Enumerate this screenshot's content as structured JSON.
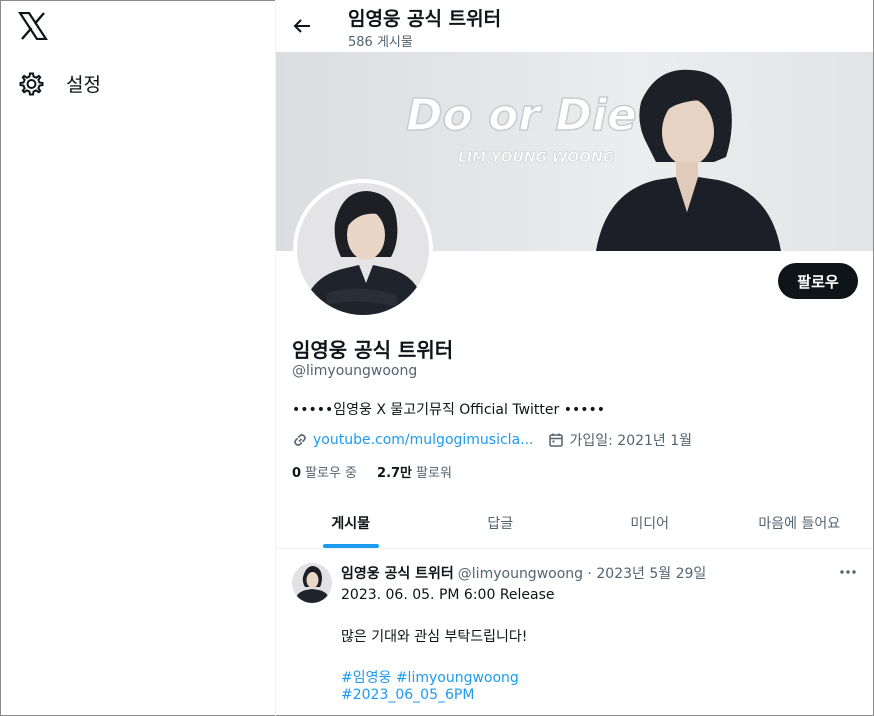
{
  "nav": {
    "settings_label": "설정"
  },
  "header": {
    "title": "임영웅 공식 트위터",
    "post_count": "586 게시물"
  },
  "banner": {
    "logo_line1": "Do or Die",
    "logo_line2": "LIM YOUNG WOONG"
  },
  "profile": {
    "name": "임영웅 공식 트위터",
    "handle": "@limyoungwoong",
    "bio": "•••••임영웅 X 물고기뮤직 Official Twitter •••••",
    "link": "youtube.com/mulgogimusicla...",
    "joined": "가입일: 2021년 1월",
    "following_count": "0",
    "following_label": "팔로우 중",
    "followers_count": "2.7만",
    "followers_label": "팔로워",
    "follow_button": "팔로우"
  },
  "tabs": [
    {
      "label": "게시물",
      "active": true
    },
    {
      "label": "답글",
      "active": false
    },
    {
      "label": "미디어",
      "active": false
    },
    {
      "label": "마음에 들어요",
      "active": false
    }
  ],
  "post": {
    "author": "임영웅 공식 트위터",
    "meta": "@limyoungwoong · 2023년 5월 29일",
    "line1": "2023. 06. 05. PM 6:00 Release",
    "line2": "많은 기대와 관심 부탁드립니다!",
    "hashtags": "#임영웅 #limyoungwoong",
    "hashtag2": "#2023_06_05_6PM"
  },
  "colors": {
    "accent": "#1d9bf0",
    "text": "#0f1419",
    "muted": "#536471",
    "button": "#0f1419"
  },
  "icons": [
    "x-logo-icon",
    "gear-icon",
    "back-arrow-icon",
    "link-icon",
    "calendar-icon",
    "more-icon"
  ]
}
